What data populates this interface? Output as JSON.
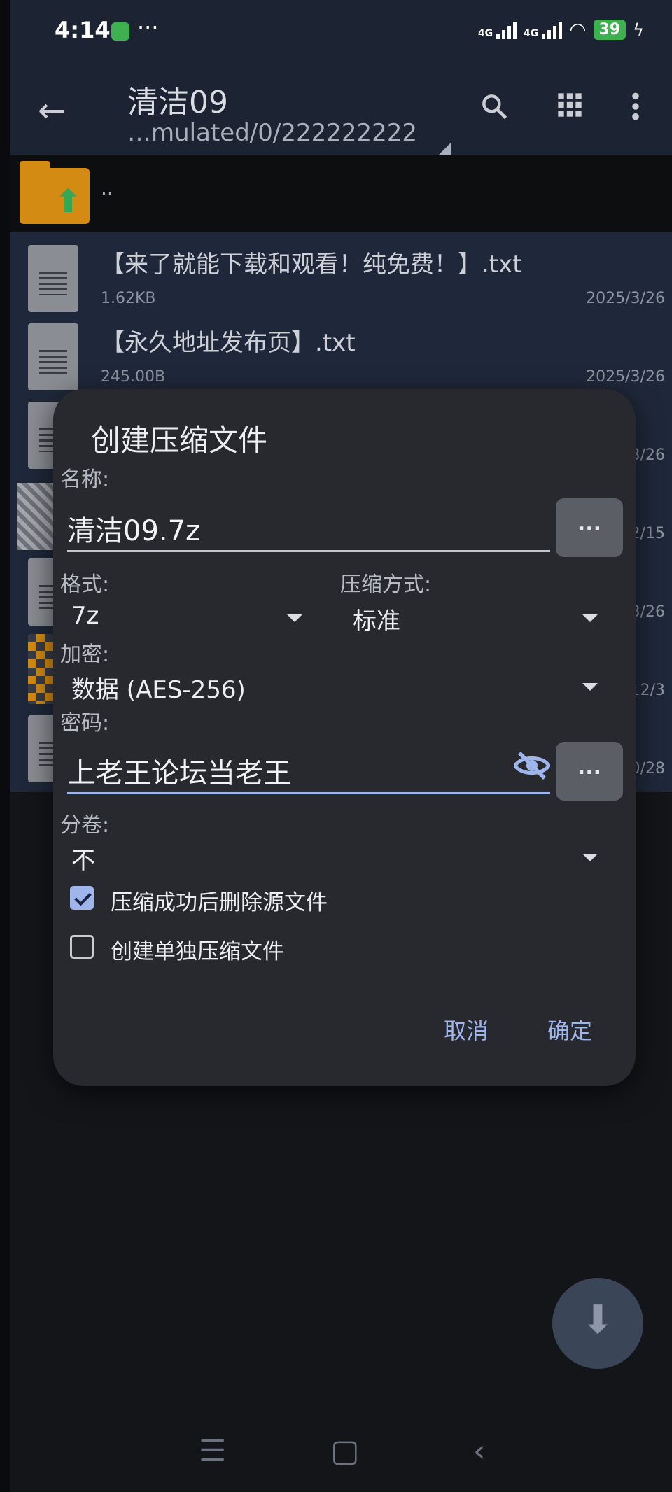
{
  "status_bar": {
    "time": "4:14",
    "dots": "···",
    "network1": "4G",
    "network2": "4G",
    "battery": "39"
  },
  "app_bar": {
    "title": "清洁09",
    "path": "…mulated/0/222222222"
  },
  "parent_row": {
    "label": ".."
  },
  "files": [
    {
      "name": "【来了就能下载和观看！纯免费！】.txt",
      "size": "1.62KB",
      "date": "2025/3/26"
    },
    {
      "name": "【永久地址发布页】.txt",
      "size": "245.00B",
      "date": "2025/3/26"
    },
    {
      "date": "3/26"
    },
    {
      "date": "2/15"
    },
    {
      "date": "3/26"
    },
    {
      "date": "12/3"
    },
    {
      "date": "0/28"
    }
  ],
  "dialog": {
    "title": "创建压缩文件",
    "name_label": "名称:",
    "name_value": "清洁09.7z",
    "more_button": "...",
    "format_label": "格式:",
    "format_value": "7z",
    "method_label": "压缩方式:",
    "method_value": "标准",
    "encrypt_label": "加密:",
    "encrypt_value": "数据 (AES-256)",
    "password_label": "密码:",
    "password_value": "上老王论坛当老王",
    "volume_label": "分卷:",
    "volume_value": "不",
    "delete_source_label": "压缩成功后删除源文件",
    "delete_source_checked": true,
    "separate_label": "创建单独压缩文件",
    "separate_checked": false,
    "cancel": "取消",
    "ok": "确定"
  },
  "icons": {
    "back": "arrow-left-icon",
    "search": "search-icon",
    "grid": "grid-view-icon",
    "menu": "more-vert-icon",
    "eye": "visibility-off-icon",
    "fab": "download-icon"
  },
  "colors": {
    "accent": "#9fb6ec",
    "appbar": "#1c2433",
    "dialog": "#27292e",
    "folder": "#d48b14"
  }
}
